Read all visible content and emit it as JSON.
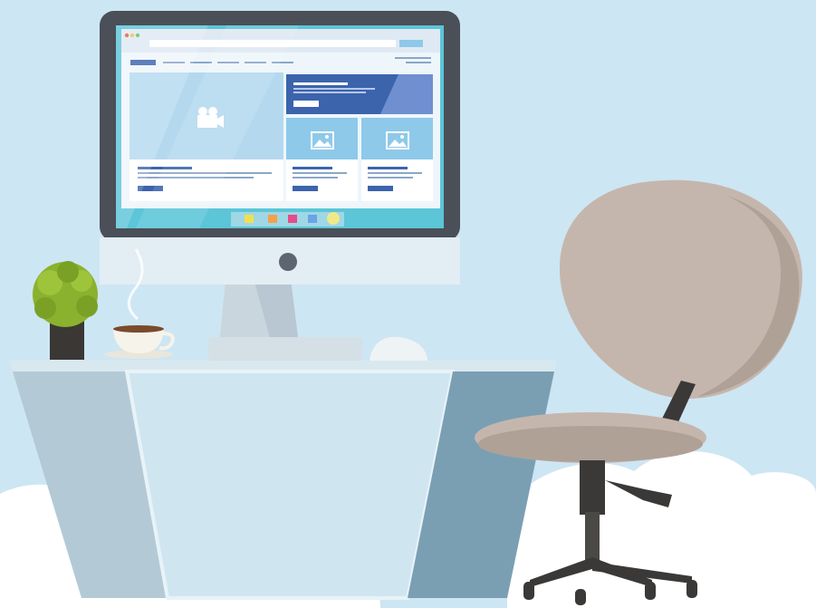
{
  "scene": {
    "description_icons": [
      "video-camera-icon",
      "image-icon",
      "image-icon"
    ],
    "colors": {
      "background": "#cde6f3",
      "monitor_frame": "#4a4f58",
      "monitor_chin": "#e3edf4",
      "screen": "#5cc5d8",
      "desk_top": "#d9e8ef",
      "desk_front": "#b9d8e6",
      "desk_side": "#7a9fb3",
      "chair_shell": "#c5b6ad",
      "chair_frame": "#3a3937",
      "cloud": "#ffffff",
      "plant_leaves": "#8ab22e",
      "ui_primary": "#3b64ad",
      "ui_accent": "#8ec9ea"
    },
    "dock_colors": [
      "#f2df4e",
      "#f5a04a",
      "#e64a8a",
      "#6aa3e6",
      "#f0e98a"
    ]
  }
}
